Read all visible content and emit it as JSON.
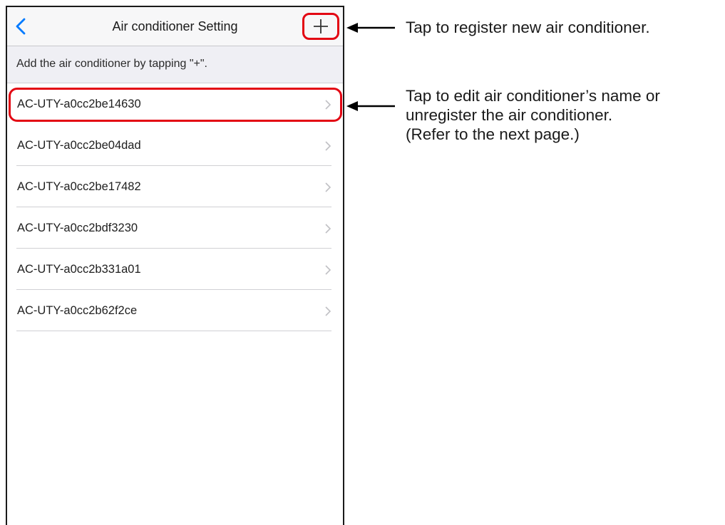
{
  "nav": {
    "title": "Air conditioner Setting",
    "back_icon": "chevron-left-icon",
    "add_icon": "plus-icon"
  },
  "hint": "Add the air conditioner by tapping \"+\".",
  "devices": [
    {
      "name": "AC-UTY-a0cc2be14630"
    },
    {
      "name": "AC-UTY-a0cc2be04dad"
    },
    {
      "name": "AC-UTY-a0cc2be17482"
    },
    {
      "name": "AC-UTY-a0cc2bdf3230"
    },
    {
      "name": "AC-UTY-a0cc2b331a01"
    },
    {
      "name": "AC-UTY-a0cc2b62f2ce"
    }
  ],
  "annotations": {
    "add": "Tap to register new air conditioner.",
    "edit_line1": "Tap to edit air conditioner’s name or",
    "edit_line2": "unregister the air conditioner.",
    "edit_line3": "(Refer to the next page.)"
  },
  "colors": {
    "highlight": "#e30613",
    "accent": "#007aff"
  }
}
